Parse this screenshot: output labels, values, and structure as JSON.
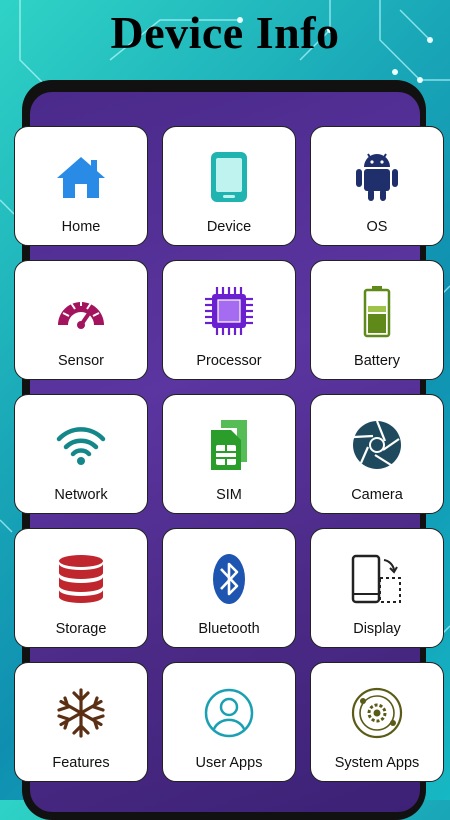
{
  "header": {
    "title": "Device Info"
  },
  "tiles": [
    {
      "label": "Home",
      "icon": "home-icon"
    },
    {
      "label": "Device",
      "icon": "device-icon"
    },
    {
      "label": "OS",
      "icon": "android-icon"
    },
    {
      "label": "Sensor",
      "icon": "gauge-icon"
    },
    {
      "label": "Processor",
      "icon": "chip-icon"
    },
    {
      "label": "Battery",
      "icon": "battery-icon"
    },
    {
      "label": "Network",
      "icon": "wifi-icon"
    },
    {
      "label": "SIM",
      "icon": "sim-icon"
    },
    {
      "label": "Camera",
      "icon": "aperture-icon"
    },
    {
      "label": "Storage",
      "icon": "database-icon"
    },
    {
      "label": "Bluetooth",
      "icon": "bluetooth-icon"
    },
    {
      "label": "Display",
      "icon": "rotate-screen-icon"
    },
    {
      "label": "Features",
      "icon": "snowflake-icon"
    },
    {
      "label": "User Apps",
      "icon": "user-icon"
    },
    {
      "label": "System Apps",
      "icon": "settings-orbit-icon"
    }
  ],
  "colors": {
    "background": "#1aa9b8",
    "phone_screen": "#4b2a86",
    "home": "#2a8be6",
    "device": "#1fb4b0",
    "android": "#1e2f6b",
    "gauge": "#a3135e",
    "chip": "#6a1fd1",
    "battery": "#5f8a1a",
    "wifi": "#13878a",
    "sim": "#2a9d2a",
    "camera": "#1f4a5e",
    "storage": "#c0262e",
    "bluetooth": "#1d55b0",
    "snowflake": "#5a2f14",
    "user": "#1aa0b2",
    "system": "#5b5a17"
  }
}
